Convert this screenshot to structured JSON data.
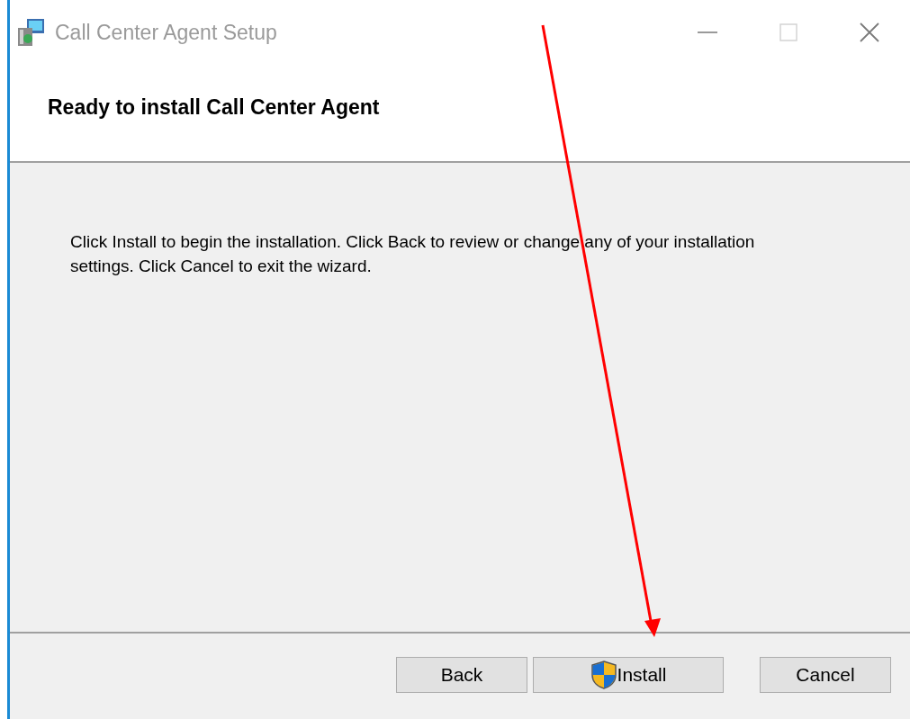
{
  "window": {
    "title": "Call Center Agent Setup"
  },
  "header": {
    "title": "Ready to install Call Center Agent"
  },
  "body": {
    "text": "Click Install to begin the installation. Click Back to review or change any of your installation settings. Click Cancel to exit the wizard."
  },
  "buttons": [
    {
      "label": "Back",
      "kind": "plain"
    },
    {
      "label": "Install",
      "kind": "shield"
    },
    {
      "label": "Cancel",
      "kind": "plain"
    }
  ]
}
